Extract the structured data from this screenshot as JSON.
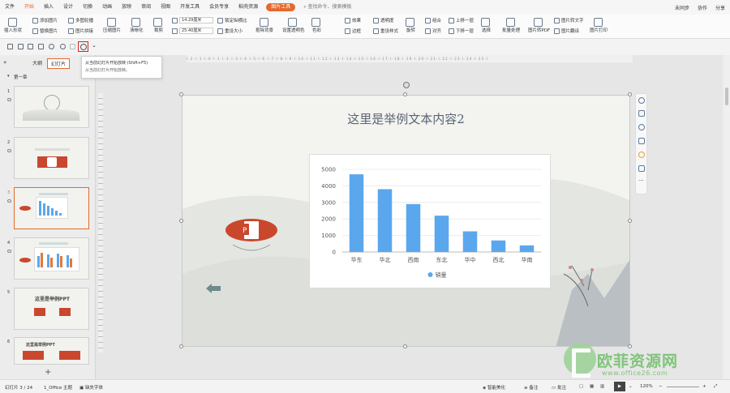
{
  "menubar": {
    "items": [
      "文件",
      "开始",
      "插入",
      "设计",
      "切换",
      "动画",
      "放映",
      "审阅",
      "视图",
      "开发工具",
      "会员专享",
      "稻壳资源"
    ],
    "context_tab": "图片工具",
    "search": "查找命令、搜索模板",
    "right": [
      "未同步",
      "协作",
      "分享"
    ]
  },
  "ribbon": {
    "insert_shape": "插入形状",
    "add_image": "添加图片",
    "multi_crop": "多图轮播",
    "replace_image": "替换图片",
    "image_splice": "图片拼接",
    "compress": "压缩图片",
    "sharpen": "清晰化",
    "crop": "裁剪",
    "height": "14.29厘米",
    "width": "25.40厘米",
    "lock_ratio": "锁定纵横比",
    "reset_size": "重设大小",
    "cutout": "抠除背景",
    "set_transparent": "设置透明色",
    "color": "色彩",
    "effects": "效果",
    "border": "边框",
    "transparency": "透明度",
    "reset_style": "重设样式",
    "rotate": "旋转",
    "group": "组合",
    "align": "对齐",
    "bring_forward": "上移一层",
    "send_backward": "下移一层",
    "select": "选择",
    "batch_process": "批量处理",
    "to_pdf": "图片转PDF",
    "to_text": "图片转文字",
    "translate": "图片翻译",
    "print": "图片打印"
  },
  "tooltip": {
    "title": "从当前幻灯片开始放映 (Shift+F5)",
    "desc": "从当前幻灯片开始放映。"
  },
  "leftpanel": {
    "tabs": [
      "大纲",
      "幻灯片"
    ],
    "section": "第一章",
    "thumb5_title": "这里是举例PPT",
    "thumb6_title": "这里是举例PPT",
    "thumb_numbers": [
      "1",
      "2",
      "3",
      "4",
      "5",
      "6"
    ]
  },
  "slide": {
    "title": "这里是举例文本内容2"
  },
  "chart_data": {
    "type": "bar",
    "categories": [
      "华东",
      "华北",
      "西南",
      "东北",
      "华中",
      "西北",
      "华南"
    ],
    "series": [
      {
        "name": "销量",
        "values": [
          4700,
          3800,
          2900,
          2200,
          1250,
          700,
          400
        ],
        "color": "#5ba7ee"
      }
    ],
    "yticks": [
      "0",
      "1000",
      "2000",
      "3000",
      "4000",
      "5000"
    ],
    "ylim": [
      0,
      5000
    ],
    "legend": "bottom"
  },
  "statusbar": {
    "slide_info": "幻灯片 3 / 24",
    "theme": "1_Office 主题",
    "missing_font": "缺失字体",
    "beautify": "智能美化",
    "notes": "备注",
    "comments": "批注",
    "zoom": "120%"
  },
  "watermark": {
    "text": "欧菲资源网",
    "url": "www.office26.com"
  }
}
